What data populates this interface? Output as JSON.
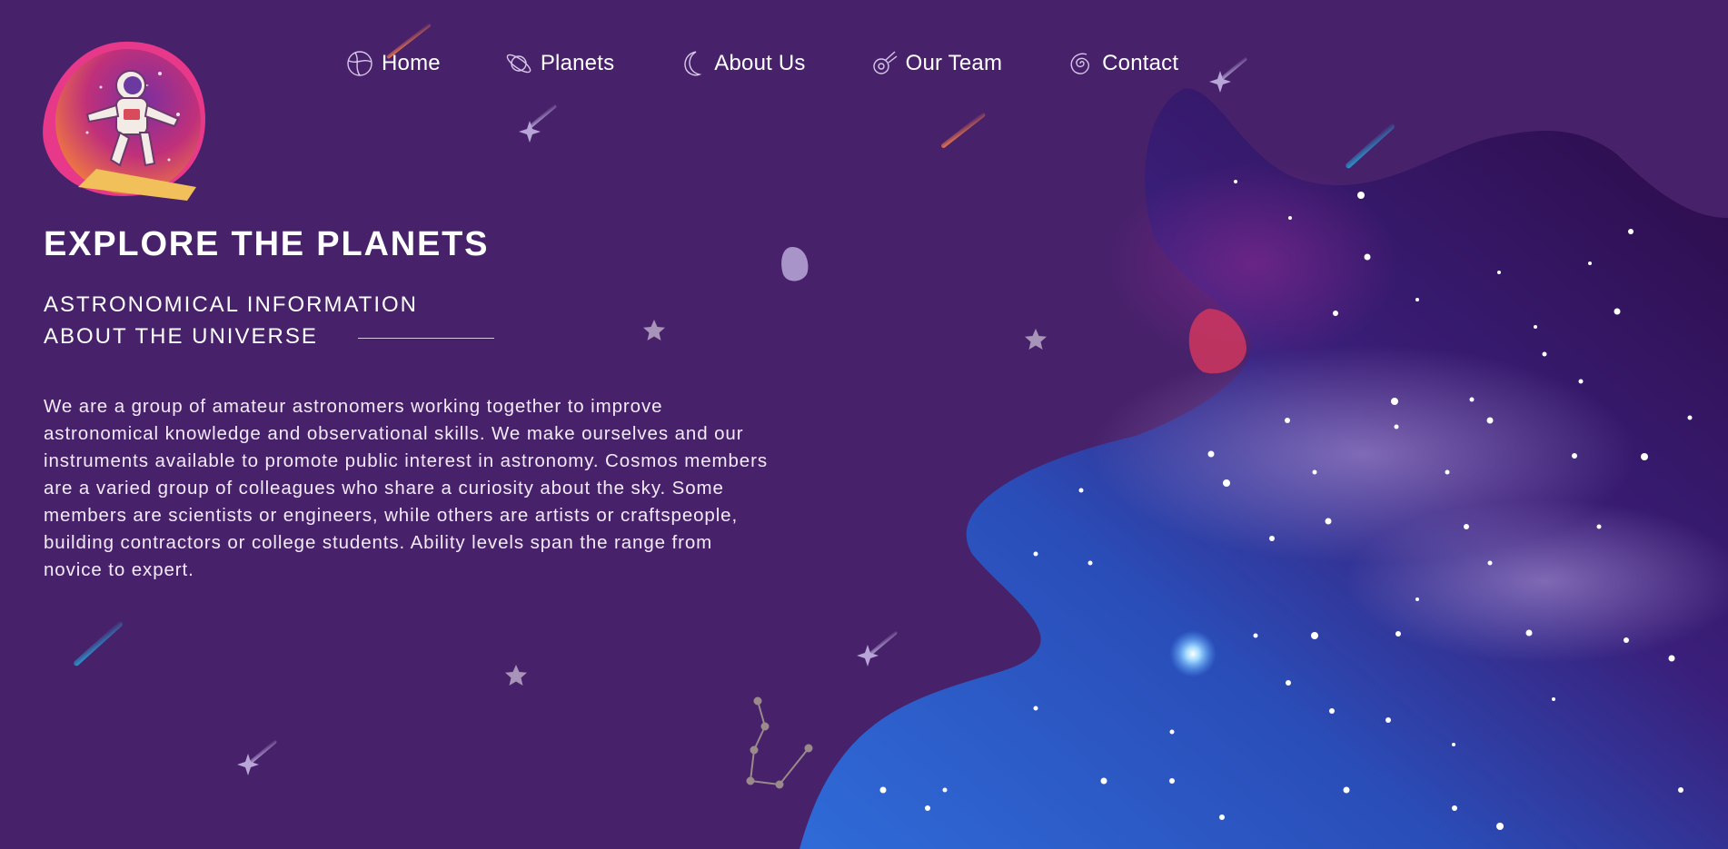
{
  "nav": {
    "items": [
      {
        "label": "Home",
        "icon": "globe-icon"
      },
      {
        "label": "Planets",
        "icon": "saturn-icon"
      },
      {
        "label": "About Us",
        "icon": "moon-icon"
      },
      {
        "label": "Our Team",
        "icon": "comet-icon"
      },
      {
        "label": "Contact",
        "icon": "spiral-galaxy-icon"
      }
    ]
  },
  "hero": {
    "title": "EXPLORE THE PLANETS",
    "subtitle_line1": "ASTRONOMICAL INFORMATION",
    "subtitle_line2": "ABOUT THE UNIVERSE",
    "body": "We are a group of amateur astronomers working together to improve astronomical knowledge and observational skills. We make ourselves and our instruments available to promote public interest in astronomy. Cosmos members are a varied group of colleagues who share a curiosity about the sky. Some members are scientists or engineers, while others are artists or craftspeople, building contractors or college students. Ability levels span the range from novice to expert."
  },
  "colors": {
    "background": "#48216b",
    "galaxy_blue": "#2f5ad0",
    "galaxy_purple": "#3a0f5a",
    "accent_pink": "#e0307a",
    "text": "#ffffff"
  }
}
